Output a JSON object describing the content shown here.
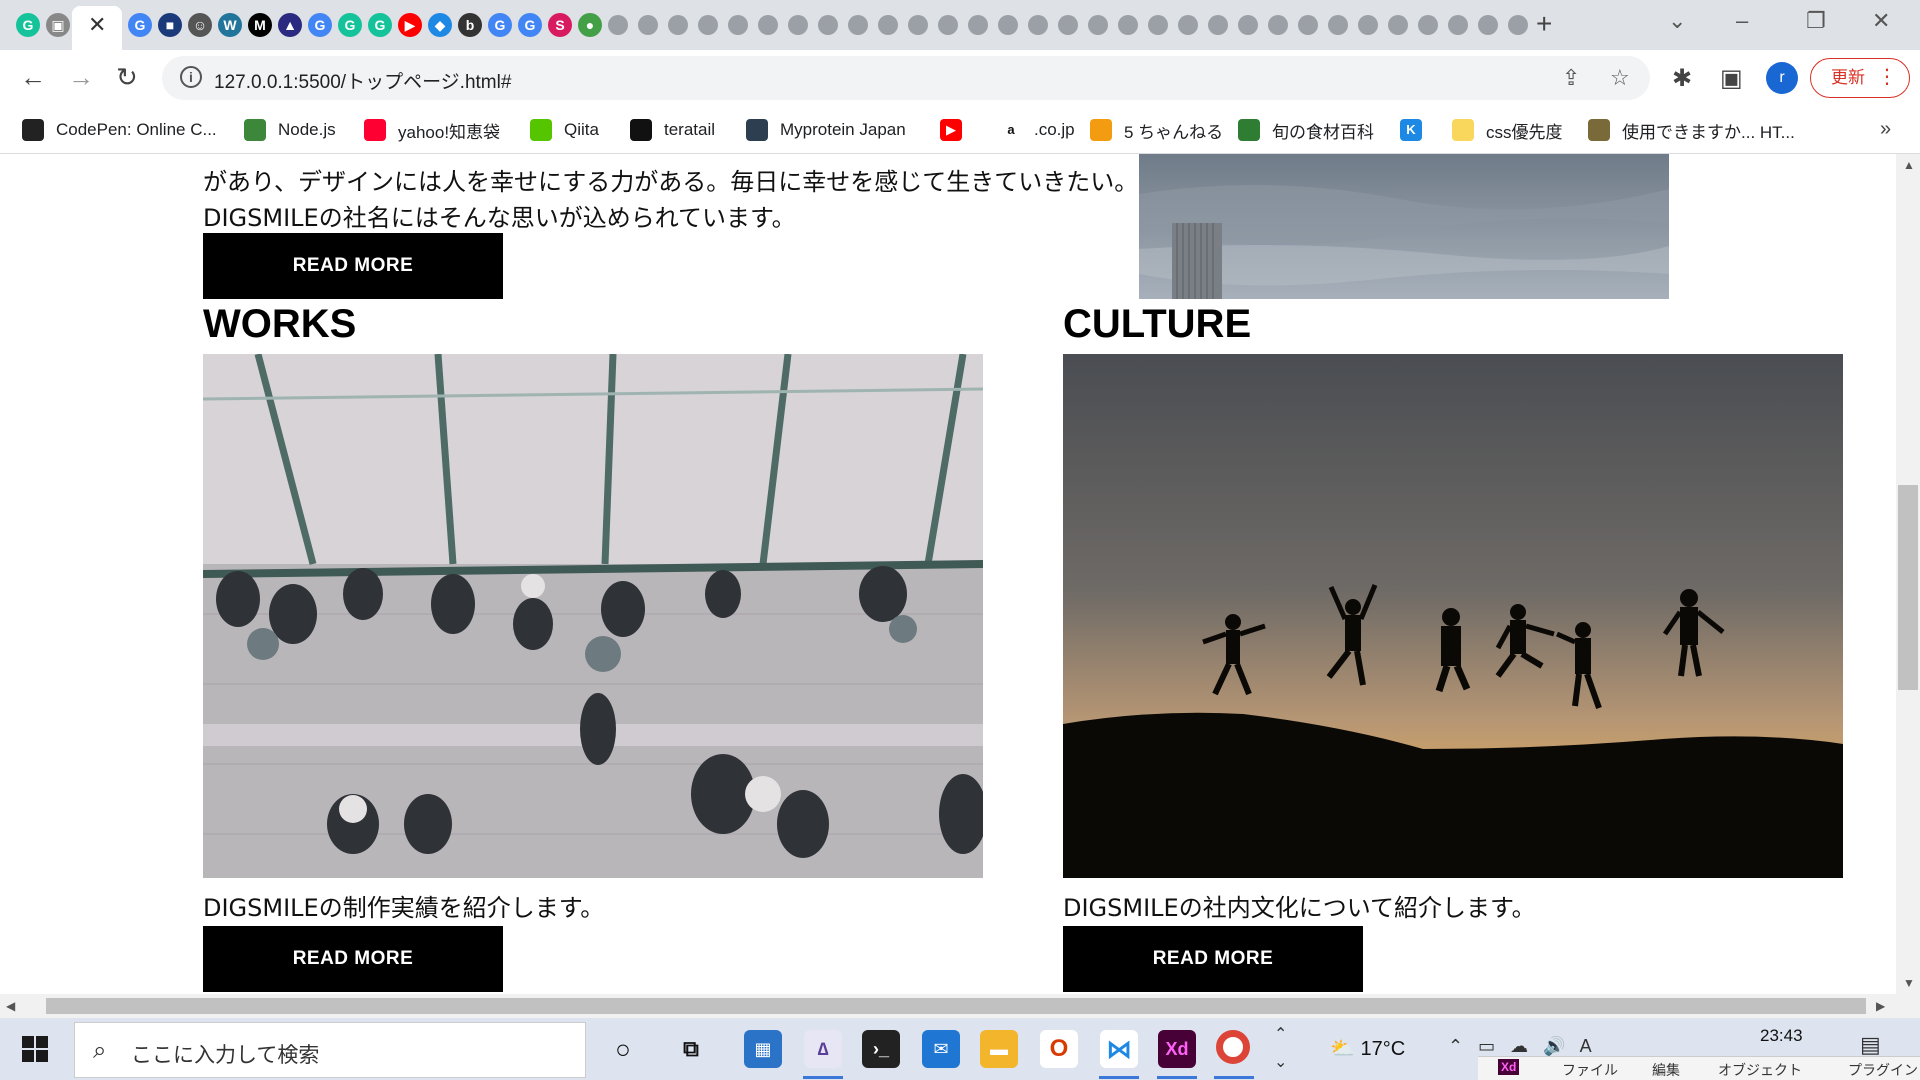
{
  "browser": {
    "tab_favicons": [
      {
        "name": "grammarly",
        "color": "#15c39a",
        "glyph": "G"
      },
      {
        "name": "tv",
        "color": "#888",
        "glyph": "▣"
      },
      {
        "name": "google",
        "color": "#4285f4",
        "glyph": "G"
      },
      {
        "name": "app",
        "color": "#1a3a7a",
        "glyph": "■"
      },
      {
        "name": "anime",
        "color": "#555",
        "glyph": "☺"
      },
      {
        "name": "wordpress",
        "color": "#21759b",
        "glyph": "W"
      },
      {
        "name": "medium",
        "color": "#000",
        "glyph": "M"
      },
      {
        "name": "image",
        "color": "#2a2a80",
        "glyph": "▲"
      },
      {
        "name": "google",
        "color": "#4285f4",
        "glyph": "G"
      },
      {
        "name": "grammarly",
        "color": "#15c39a",
        "glyph": "G"
      },
      {
        "name": "grammarly",
        "color": "#15c39a",
        "glyph": "G"
      },
      {
        "name": "youtube",
        "color": "#ff0000",
        "glyph": "▶"
      },
      {
        "name": "puzzle",
        "color": "#1e88e5",
        "glyph": "◆"
      },
      {
        "name": "bing",
        "color": "#333",
        "glyph": "b"
      },
      {
        "name": "google",
        "color": "#4285f4",
        "glyph": "G"
      },
      {
        "name": "google",
        "color": "#4285f4",
        "glyph": "G"
      },
      {
        "name": "sumo",
        "color": "#d81b60",
        "glyph": "S"
      },
      {
        "name": "leaf",
        "color": "#43a047",
        "glyph": "●"
      }
    ],
    "address": "127.0.0.1:5500/トップページ.html#",
    "update_label": "更新",
    "avatar_letter": "r",
    "bookmarks": [
      {
        "label": "CodePen: Online C...",
        "icon": "codepen-icon",
        "color": "#222"
      },
      {
        "label": "Node.js",
        "icon": "nodejs-icon",
        "color": "#3c873a"
      },
      {
        "label": "yahoo!知恵袋",
        "icon": "yahoo-icon",
        "color": "#ff0033"
      },
      {
        "label": "Qiita",
        "icon": "qiita-icon",
        "color": "#55c500"
      },
      {
        "label": "teratail",
        "icon": "teratail-icon",
        "color": "#111"
      },
      {
        "label": "Myprotein Japan",
        "icon": "myprotein-icon",
        "color": "#2c3e50"
      },
      {
        "label": "",
        "icon": "youtube-icon",
        "color": "#ff0000"
      },
      {
        "label": ".co.jp",
        "icon": "amazon-icon",
        "color": "#fff"
      },
      {
        "label": "5 ちゃんねる",
        "icon": "5ch-icon",
        "color": "#f39c12"
      },
      {
        "label": "旬の食材百科",
        "icon": "shun-icon",
        "color": "#2e7d32"
      },
      {
        "label": "",
        "icon": "k-icon",
        "color": "#1e88e5"
      },
      {
        "label": "css優先度",
        "icon": "folder-icon",
        "color": "#f9d65c"
      },
      {
        "label": "使用できますか... HT...",
        "icon": "caniuse-icon",
        "color": "#7a6a3a"
      }
    ]
  },
  "page": {
    "intro_line1": "があり、デザインには人を幸せにする力がある。毎日に幸せを感じて生きていきたい。",
    "intro_line2": "DIGSMILEの社名にはそんな思いが込められています。",
    "read_more": "READ MORE",
    "works": {
      "title": "WORKS",
      "description": "DIGSMILEの制作実績を紹介します。"
    },
    "culture": {
      "title": "CULTURE",
      "description": "DIGSMILEの社内文化について紹介します。"
    }
  },
  "taskbar": {
    "search_placeholder": "ここに入力して検索",
    "weather": "17°C",
    "time": "23:43",
    "xd_menu": [
      "ファイル",
      "編集",
      "オブジェクト",
      "プラグイン"
    ]
  }
}
